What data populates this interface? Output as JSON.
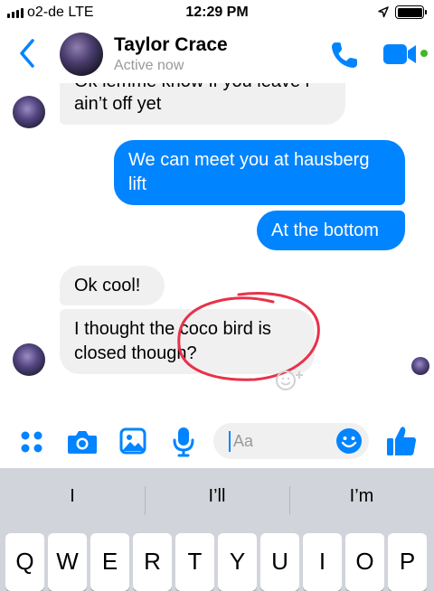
{
  "status_bar": {
    "carrier": "o2-de  LTE",
    "time": "12:29 PM",
    "icons": [
      "signal-icon",
      "location-icon",
      "battery-icon"
    ]
  },
  "header": {
    "contact_name": "Taylor Crace",
    "status": "Active now",
    "icons": [
      "back-icon",
      "phone-icon",
      "video-call-icon"
    ],
    "accent_color": "#0084ff",
    "online_color": "#42b72a"
  },
  "messages": [
    {
      "from": "contact",
      "text_cut": "Ok lemme know if you leave i",
      "text": "ain’t off yet"
    },
    {
      "from": "me",
      "lines": [
        "We can meet you at hausberg",
        "lift"
      ]
    },
    {
      "from": "me",
      "text": "At the bottom"
    },
    {
      "from": "contact",
      "text": "Ok cool!"
    },
    {
      "from": "contact",
      "lines": [
        "I thought the coco bird is",
        "closed though?"
      ]
    }
  ],
  "composer": {
    "placeholder": "Aa",
    "icons": [
      "apps-icon",
      "camera-icon",
      "gallery-icon",
      "microphone-icon",
      "emoji-icon",
      "thumbs-up-icon"
    ]
  },
  "keyboard": {
    "suggestions": [
      "I",
      "I’ll",
      "I’m"
    ],
    "row1": [
      "Q",
      "W",
      "E",
      "R",
      "T",
      "Y",
      "U",
      "I",
      "O",
      "P"
    ]
  },
  "colors": {
    "bubble_out": "#0084ff",
    "bubble_in": "#f1f0f0",
    "annotation": "#e8324a",
    "keyboard_bg": "#d1d4da"
  }
}
